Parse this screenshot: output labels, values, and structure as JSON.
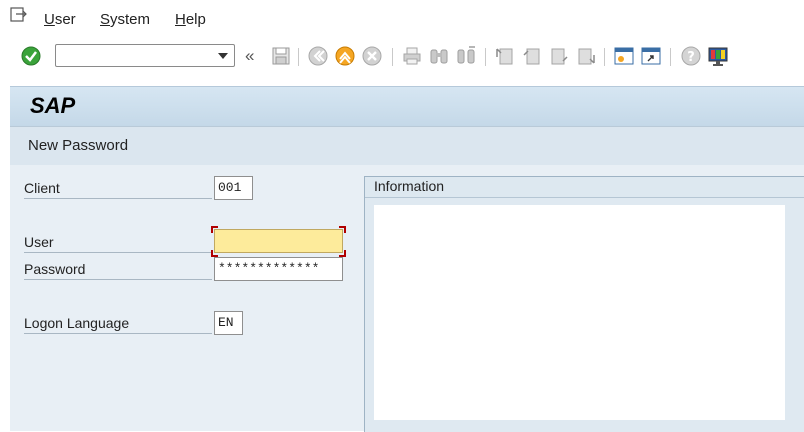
{
  "menu": {
    "items": [
      {
        "label": "User",
        "underline": "U",
        "rest": "ser"
      },
      {
        "label": "System",
        "underline": "S",
        "rest": "ystem"
      },
      {
        "label": "Help",
        "underline": "H",
        "rest": "elp"
      }
    ]
  },
  "toolbar": {
    "command_value": "",
    "double_arrow": "«",
    "icons": [
      "enter-checkmark-icon",
      "save-icon",
      "back-icon",
      "exit-icon",
      "cancel-icon",
      "print-icon",
      "find-icon",
      "find-next-icon",
      "first-page-icon",
      "previous-page-icon",
      "next-page-icon",
      "last-page-icon",
      "new-session-icon",
      "create-shortcut-icon",
      "help-icon",
      "customize-layout-icon"
    ]
  },
  "header": {
    "logo": "SAP",
    "subtitle": "New Password"
  },
  "form": {
    "client_label": "Client",
    "client_value": "001",
    "user_label": "User",
    "user_value": "",
    "password_label": "Password",
    "password_value": "*************",
    "language_label": "Logon Language",
    "language_value": "EN"
  },
  "info_panel": {
    "title": "Information"
  },
  "colors": {
    "title_bg": "#c9dcea",
    "content_bg": "#e8eff5",
    "required_field": "#fdeb9b",
    "accent_orange": "#f5a623",
    "check_green": "#3aa33a"
  }
}
